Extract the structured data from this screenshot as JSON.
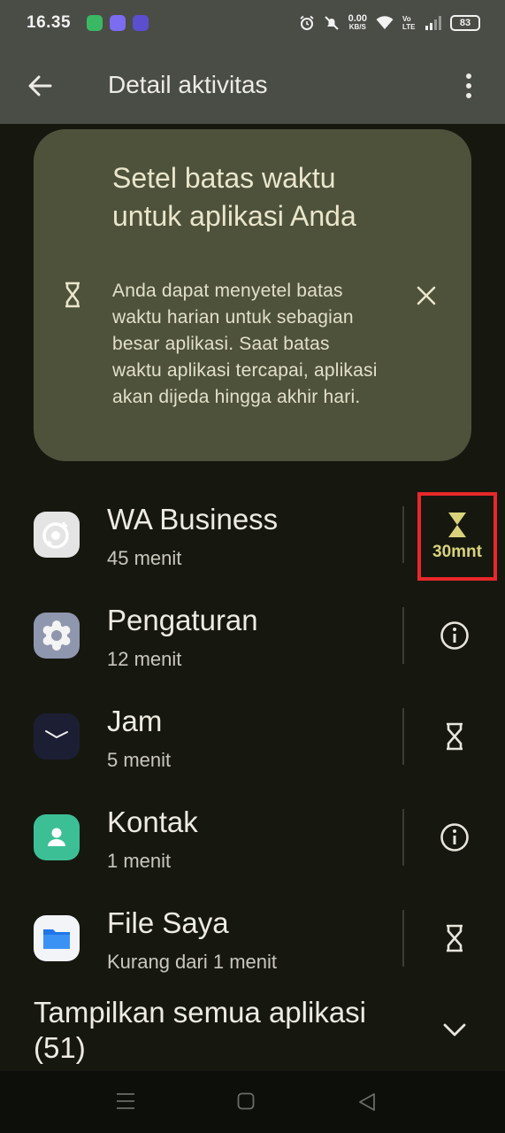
{
  "status_bar": {
    "time": "16.35",
    "net_speed": "0.00",
    "net_unit": "KB/S",
    "volte": "Vo LTE",
    "battery": "83"
  },
  "app_bar": {
    "title": "Detail aktivitas"
  },
  "tip_card": {
    "title": "Setel batas waktu untuk aplikasi Anda",
    "body": "Anda dapat menyetel batas waktu harian untuk sebagian besar aplikasi. Saat batas waktu aplikasi tercapai, aplikasi akan dijeda hingga akhir hari."
  },
  "apps": [
    {
      "name": "WA Business",
      "time": "45 menit",
      "action": "hourglass-icon",
      "limit": "30mnt"
    },
    {
      "name": "Pengaturan",
      "time": "12 menit",
      "action": "info-icon"
    },
    {
      "name": "Jam",
      "time": "5 menit",
      "action": "hourglass-icon"
    },
    {
      "name": "Kontak",
      "time": "1 menit",
      "action": "info-icon"
    },
    {
      "name": "File Saya",
      "time": "Kurang dari 1 menit",
      "action": "hourglass-icon"
    }
  ],
  "show_all": {
    "label": "Tampilkan semua aplikasi (51)"
  },
  "colors": {
    "background": "#161810",
    "app_bar": "#4a4c46",
    "card": "#4f523b",
    "limit_accent": "#d9d27c",
    "highlight_box": "#e8282a"
  }
}
